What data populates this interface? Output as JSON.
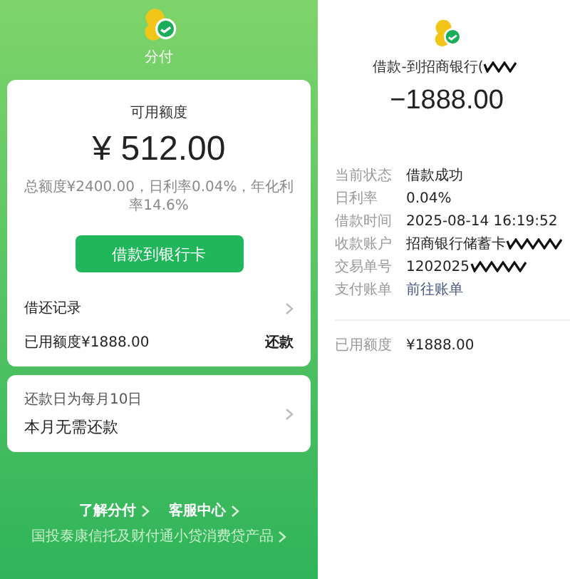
{
  "home": {
    "app_name": "分付",
    "available": {
      "label": "可用额度",
      "amount": "¥ 512.00",
      "terms": "总额度¥2400.00，日利率0.04%，年化利率14.6%"
    },
    "borrow_button": "借款到银行卡",
    "records_label": "借还记录",
    "used": {
      "label": "已用额度¥1888.00",
      "action": "还款"
    },
    "repay": {
      "note": "还款日为每月10日",
      "status": "本月无需还款"
    },
    "footer_links": [
      "了解分付",
      "客服中心"
    ],
    "footer_note": "国投泰康信托及财付通小贷消费贷产品"
  },
  "detail": {
    "title": "借款-到招商银行(",
    "title_redacted": true,
    "amount": "−1888.00",
    "rows": [
      {
        "label": "当前状态",
        "value": "借款成功",
        "kind": "text",
        "redacted": false
      },
      {
        "label": "日利率",
        "value": "0.04%",
        "kind": "text",
        "redacted": false
      },
      {
        "label": "借款时间",
        "value": "2025-08-14 16:19:52",
        "kind": "text",
        "redacted": false
      },
      {
        "label": "收款账户",
        "value": "招商银行储蓄卡",
        "kind": "text",
        "redacted": true
      },
      {
        "label": "交易单号",
        "value": "1202025",
        "kind": "text",
        "redacted": true
      },
      {
        "label": "支付账单",
        "value": "前往账单",
        "kind": "link",
        "redacted": false
      }
    ],
    "used": {
      "label": "已用额度",
      "value": "¥1888.00"
    }
  }
}
